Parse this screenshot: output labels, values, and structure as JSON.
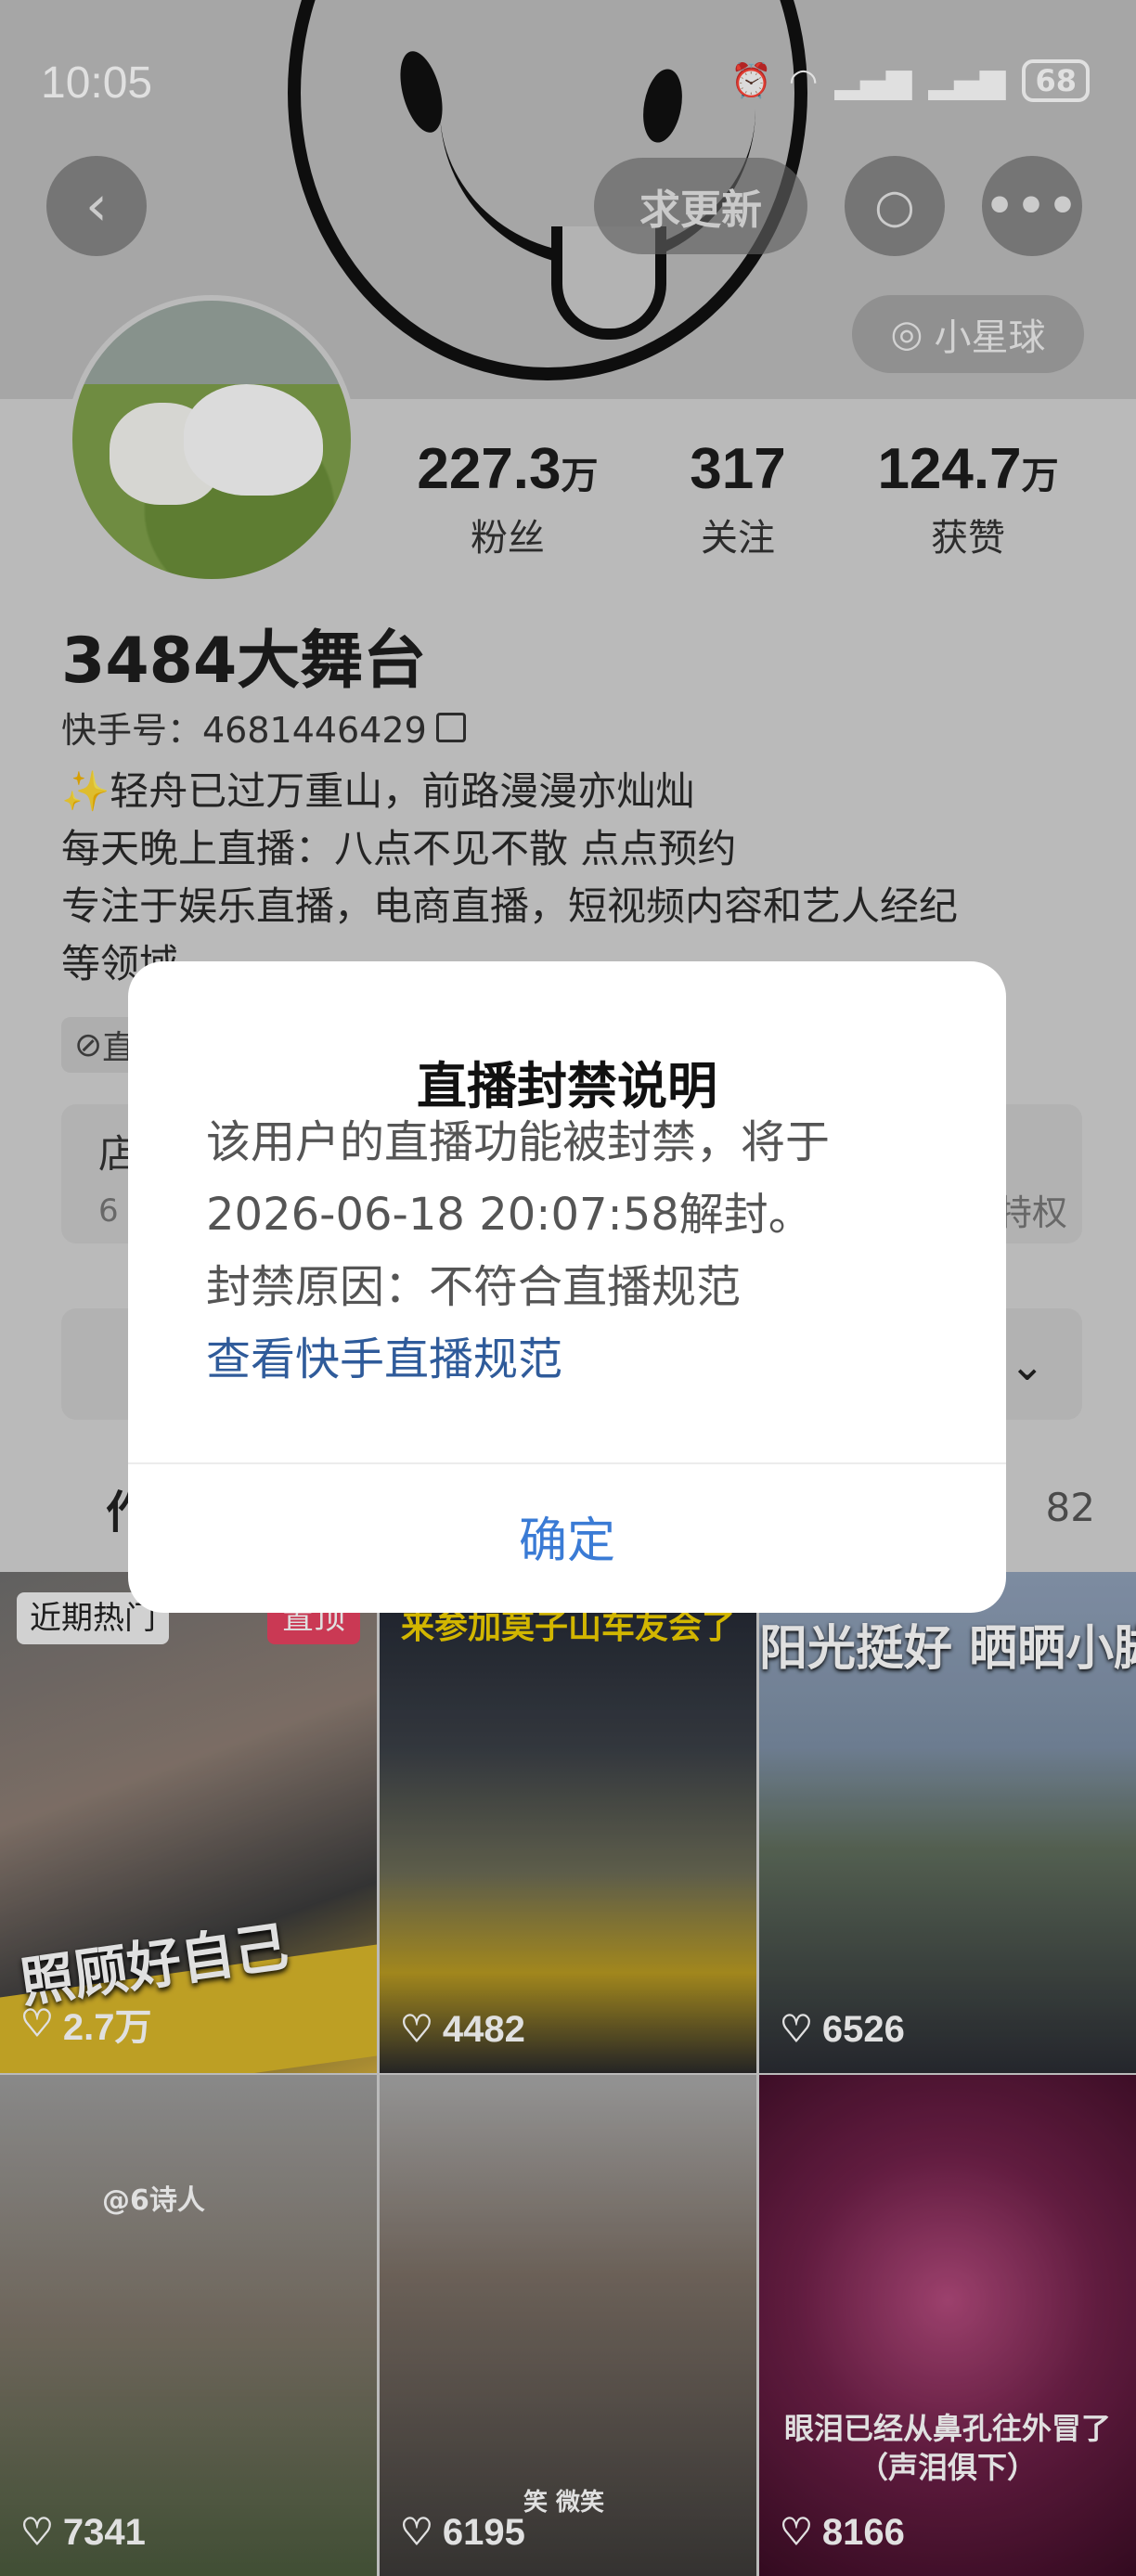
{
  "status_bar": {
    "time": "10:05",
    "battery": "68"
  },
  "header": {
    "update_label": "求更新",
    "planet_label": "小星球"
  },
  "profile": {
    "stats": [
      {
        "value": "227.3",
        "unit": "万",
        "label": "粉丝"
      },
      {
        "value": "317",
        "unit": "",
        "label": "关注"
      },
      {
        "value": "124.7",
        "unit": "万",
        "label": "获赞"
      }
    ],
    "nickname": "3484大舞台",
    "kuaishou_id": "快手号：4681446429",
    "bio": [
      "✨轻舟已过万重山，前路漫漫亦灿灿",
      "每天晚上直播：八点不见不散 点点预约",
      "专注于娱乐直播，电商直播，短视频内容和艺人经纪",
      "等领域"
    ],
    "tag_chip": "直",
    "shop": {
      "title": "店",
      "subtitle": "6",
      "right_text": "特权"
    },
    "tabs": {
      "left": "作",
      "right_count": "82"
    }
  },
  "videos": [
    {
      "likes": "2.7万",
      "badge_hot": "近期热门",
      "badge_top": "置顶",
      "overlay_text": "照顾好自己"
    },
    {
      "likes": "4482",
      "overlay_text": "来参加莫子山车友会了"
    },
    {
      "likes": "6526",
      "overlay_text": "阳光挺好 晒晒小脚"
    },
    {
      "likes": "7341",
      "overlay_text": "@6诗人"
    },
    {
      "likes": "6195",
      "overlay_text": "笑 微笑"
    },
    {
      "likes": "8166",
      "overlay_text": "眼泪已经从鼻孔往外冒了（声泪俱下）"
    }
  ],
  "dialog": {
    "title": "直播封禁说明",
    "line1": "该用户的直播功能被封禁，将于",
    "line2": "2026-06-18 20:07:58解封。",
    "line3": "封禁原因：不符合直播规范",
    "link": "查看快手直播规范",
    "confirm": "确定"
  }
}
